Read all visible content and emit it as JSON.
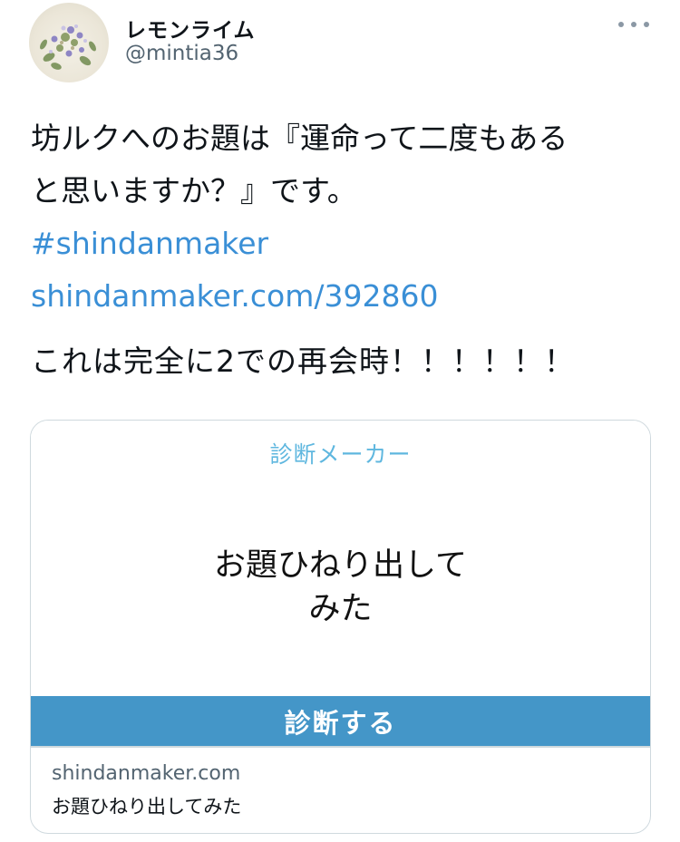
{
  "author": {
    "display_name": "レモンライム",
    "handle": "@mintia36"
  },
  "tweet": {
    "line1": "坊ルクへのお題は『運命って二度もある",
    "line2": "と思いますか？』です。",
    "hashtag": "#shindanmaker",
    "link": "shindanmaker.com/392860",
    "line5": "これは完全に2での再会時！！！！！！"
  },
  "card": {
    "site_title": "診断メーカー",
    "headline_line1": "お題ひねり出して",
    "headline_line2": "みた",
    "action_label": "診断する",
    "domain": "shindanmaker.com",
    "description": "お題ひねり出してみた"
  },
  "colors": {
    "link": "#3a8fd6",
    "card_site_title": "#5fb7df",
    "card_action_bar": "#4496c8",
    "secondary_text": "#536471"
  },
  "icons": {
    "more": "more-horizontal-icon",
    "avatar": "bouquet-avatar"
  }
}
